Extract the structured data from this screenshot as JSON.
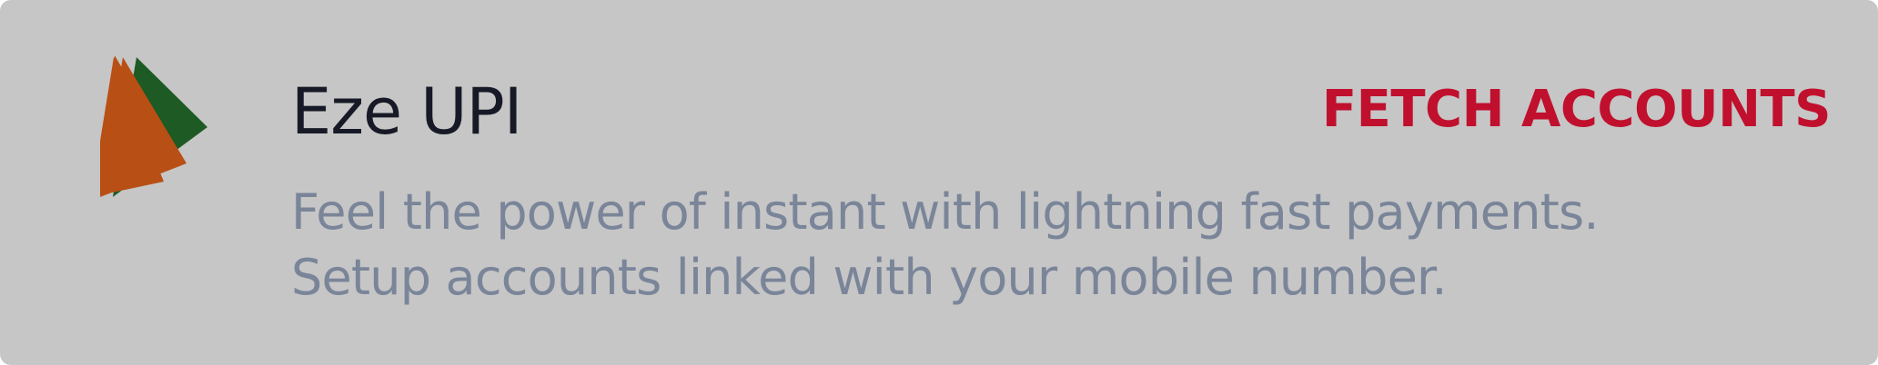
{
  "card": {
    "title": "Eze UPI",
    "action_label": "FETCH ACCOUNTS",
    "description_lines": [
      "Feel the power of instant with lightning fast payments.",
      "Setup accounts linked with your mobile number."
    ],
    "logo_icon": "upi-logo-icon"
  },
  "colors": {
    "card_background": "#c6c6c6",
    "title": "#171a26",
    "action": "#c0102e",
    "description": "#7a8599",
    "logo_orange": "#b84f15",
    "logo_green": "#1d5a24"
  }
}
